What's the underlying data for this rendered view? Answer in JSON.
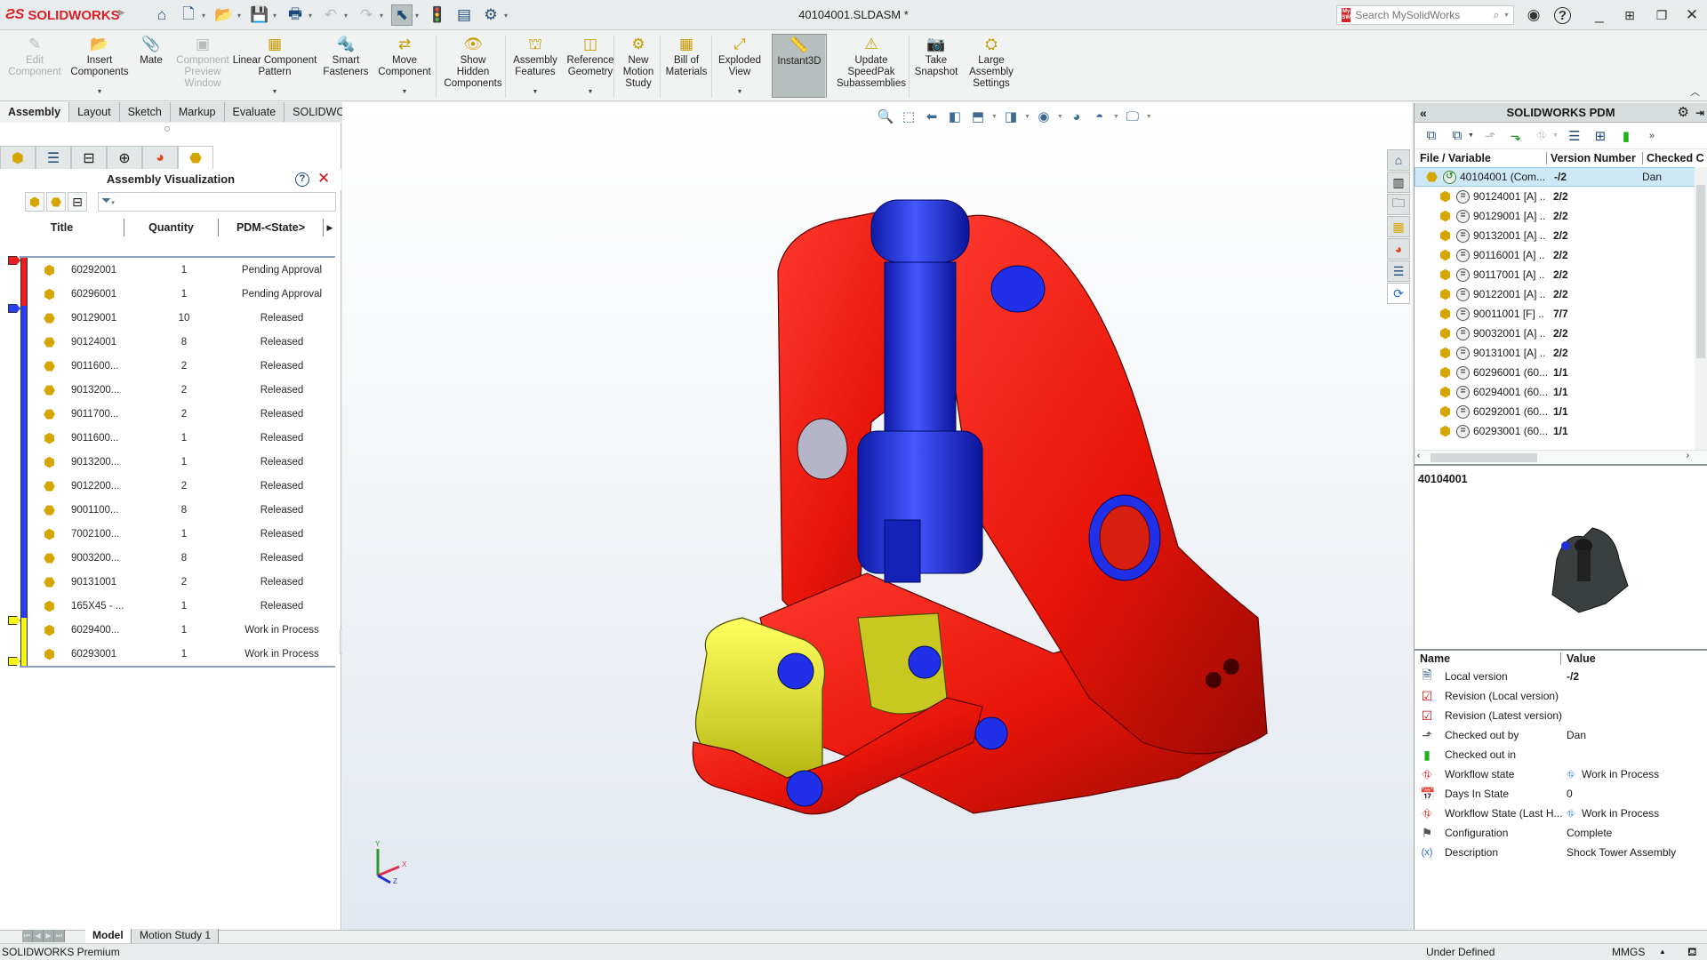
{
  "app": {
    "brand": "SOLIDWORKS",
    "document_title": "40104001.SLDASM *",
    "search_placeholder": "Search MySolidWorks"
  },
  "quick_access": [
    {
      "name": "home",
      "glyph": "⌂"
    },
    {
      "name": "new-document",
      "glyph": "🗋"
    },
    {
      "name": "open",
      "glyph": "📂"
    },
    {
      "name": "save",
      "glyph": "💾"
    },
    {
      "name": "print",
      "glyph": "🖶"
    },
    {
      "name": "undo",
      "glyph": "↶"
    },
    {
      "name": "redo",
      "glyph": "↷"
    },
    {
      "name": "select",
      "glyph": "⬉"
    },
    {
      "name": "rebuild",
      "glyph": "🚦"
    },
    {
      "name": "file-properties",
      "glyph": "▤"
    },
    {
      "name": "options",
      "glyph": "⚙"
    }
  ],
  "ribbon": {
    "commands": [
      {
        "label": "Edit\nComponent",
        "glyph": "✎",
        "disabled": true,
        "caret": false
      },
      {
        "label": "Insert\nComponents",
        "glyph": "📂",
        "disabled": false,
        "caret": true
      },
      {
        "label": "Mate",
        "glyph": "📎",
        "disabled": false,
        "caret": false
      },
      {
        "label": "Component\nPreview\nWindow",
        "glyph": "▣",
        "disabled": true,
        "caret": false
      },
      {
        "label": "Linear Component\nPattern",
        "glyph": "▦",
        "disabled": false,
        "caret": true
      },
      {
        "label": "Smart\nFasteners",
        "glyph": "🔩",
        "disabled": false,
        "caret": false
      },
      {
        "label": "Move\nComponent",
        "glyph": "⇄",
        "disabled": false,
        "caret": true
      },
      {
        "label": "Show\nHidden\nComponents",
        "glyph": "👁",
        "disabled": false,
        "caret": false
      },
      {
        "label": "Assembly\nFeatures",
        "glyph": "⛫",
        "disabled": false,
        "caret": true
      },
      {
        "label": "Reference\nGeometry",
        "glyph": "◫",
        "disabled": false,
        "caret": true
      },
      {
        "label": "New\nMotion\nStudy",
        "glyph": "⚙",
        "disabled": false,
        "caret": false
      },
      {
        "label": "Bill of\nMaterials",
        "glyph": "▦",
        "disabled": false,
        "caret": false
      },
      {
        "label": "Exploded\nView",
        "glyph": "⤢",
        "disabled": false,
        "caret": true
      },
      {
        "label": "Instant3D",
        "glyph": "📏",
        "disabled": false,
        "caret": false,
        "active": true
      },
      {
        "label": "Update\nSpeedPak\nSubassemblies",
        "glyph": "⚠",
        "disabled": false,
        "caret": false
      },
      {
        "label": "Take\nSnapshot",
        "glyph": "📷",
        "disabled": false,
        "caret": false
      },
      {
        "label": "Large\nAssembly\nSettings",
        "glyph": "⛭",
        "disabled": false,
        "caret": false
      }
    ],
    "tabs": [
      "Assembly",
      "Layout",
      "Sketch",
      "Markup",
      "Evaluate",
      "SOLIDWORKS Add-Ins"
    ],
    "active_tab": "Assembly"
  },
  "heads_up_toolbar": [
    {
      "name": "zoom-to-fit",
      "glyph": "🔍"
    },
    {
      "name": "zoom-to-area",
      "glyph": "⬚"
    },
    {
      "name": "previous-view",
      "glyph": "⬅"
    },
    {
      "name": "section-view",
      "glyph": "◧"
    },
    {
      "name": "view-orientation",
      "glyph": "⬒"
    },
    {
      "name": "display-style",
      "glyph": "◨"
    },
    {
      "name": "hide-show-items",
      "glyph": "◉"
    },
    {
      "name": "edit-appearance",
      "glyph": "◕"
    },
    {
      "name": "apply-scene",
      "glyph": "◓"
    },
    {
      "name": "view-settings",
      "glyph": "🖵"
    }
  ],
  "feature_manager": {
    "tabs": [
      "feature-tree",
      "property-manager",
      "configuration-manager",
      "dimxpert",
      "display-manager",
      "assembly-visualization"
    ],
    "panel_title": "Assembly Visualization",
    "columns": [
      "Title",
      "Quantity",
      "PDM-<State>"
    ],
    "rows": [
      {
        "title": "60292001",
        "qty": "1",
        "state": "Pending Approval",
        "type": "part"
      },
      {
        "title": "60296001",
        "qty": "1",
        "state": "Pending Approval",
        "type": "part"
      },
      {
        "title": "90129001",
        "qty": "10",
        "state": "Released",
        "type": "multi"
      },
      {
        "title": "90124001",
        "qty": "8",
        "state": "Released",
        "type": "multi"
      },
      {
        "title": "9011600...",
        "qty": "2",
        "state": "Released",
        "type": "multi"
      },
      {
        "title": "9013200...",
        "qty": "2",
        "state": "Released",
        "type": "multi"
      },
      {
        "title": "9011700...",
        "qty": "2",
        "state": "Released",
        "type": "multi"
      },
      {
        "title": "9011600...",
        "qty": "1",
        "state": "Released",
        "type": "part"
      },
      {
        "title": "9013200...",
        "qty": "1",
        "state": "Released",
        "type": "part"
      },
      {
        "title": "9012200...",
        "qty": "2",
        "state": "Released",
        "type": "multi"
      },
      {
        "title": "9001100...",
        "qty": "8",
        "state": "Released",
        "type": "multi"
      },
      {
        "title": "7002100...",
        "qty": "1",
        "state": "Released",
        "type": "part"
      },
      {
        "title": "9003200...",
        "qty": "8",
        "state": "Released",
        "type": "multi"
      },
      {
        "title": "90131001",
        "qty": "2",
        "state": "Released",
        "type": "multi"
      },
      {
        "title": "165X45 - ...",
        "qty": "1",
        "state": "Released",
        "type": "part"
      },
      {
        "title": "6029400...",
        "qty": "1",
        "state": "Work in Process",
        "type": "part"
      },
      {
        "title": "60293001",
        "qty": "1",
        "state": "Work in Process",
        "type": "part"
      }
    ],
    "state_bar": [
      {
        "state": "Pending Approval",
        "color": "#ee1c1c",
        "count": 2
      },
      {
        "state": "Released",
        "color": "#2b3ff0",
        "count": 13
      },
      {
        "state": "Work in Process",
        "color": "#f5f51a",
        "count": 2
      }
    ]
  },
  "viewport": {
    "model_name": "Shock Tower Assembly",
    "colors": {
      "red": "#ee1b10",
      "blue": "#2030e8",
      "yellow": "#eeee22"
    },
    "triad": {
      "x": "X",
      "y": "Y",
      "z": "Z"
    }
  },
  "bottom_tabs": [
    "Model",
    "Motion Study 1"
  ],
  "active_bottom_tab": "Model",
  "status_bar": {
    "product": "SOLIDWORKS Premium",
    "state": "Under Defined",
    "units": "MMGS"
  },
  "pdm": {
    "title": "SOLIDWORKS PDM",
    "columns": [
      "File / Variable",
      "Version Number",
      "Checked C"
    ],
    "files": [
      {
        "name": "40104001  (Com...",
        "version": "-/2",
        "checked_out": "Dan",
        "level": 0,
        "selected": true
      },
      {
        "name": "90124001  [A] ..",
        "version": "2/2",
        "level": 1
      },
      {
        "name": "90129001  [A] ..",
        "version": "2/2",
        "level": 1
      },
      {
        "name": "90132001  [A] ..",
        "version": "2/2",
        "level": 1
      },
      {
        "name": "90116001  [A] ..",
        "version": "2/2",
        "level": 1
      },
      {
        "name": "90117001  [A] ..",
        "version": "2/2",
        "level": 1
      },
      {
        "name": "90122001  [A] ..",
        "version": "2/2",
        "level": 1
      },
      {
        "name": "90011001  [F] ..",
        "version": "7/7",
        "level": 1
      },
      {
        "name": "90032001  [A] ..",
        "version": "2/2",
        "level": 1
      },
      {
        "name": "90131001  [A] ..",
        "version": "2/2",
        "level": 1
      },
      {
        "name": "60296001  (60...",
        "version": "1/1",
        "level": 1
      },
      {
        "name": "60294001  (60...",
        "version": "1/1",
        "level": 1
      },
      {
        "name": "60292001  (60...",
        "version": "1/1",
        "level": 1
      },
      {
        "name": "60293001  (60...",
        "version": "1/1",
        "level": 1
      }
    ],
    "preview_name": "40104001",
    "props_columns": [
      "Name",
      "Value"
    ],
    "properties": [
      {
        "icon": "local-version",
        "glyph": "🗎",
        "name": "Local version",
        "value": "-/2",
        "bold": true
      },
      {
        "icon": "revision-check",
        "glyph": "☑",
        "name": "Revision (Local version)",
        "value": ""
      },
      {
        "icon": "revision-check",
        "glyph": "☑",
        "name": "Revision (Latest version)",
        "value": ""
      },
      {
        "icon": "check-out",
        "glyph": "⬏",
        "name": "Checked out by",
        "value": "Dan"
      },
      {
        "icon": "checked-out-in",
        "glyph": "▮",
        "name": "Checked out in",
        "value": ""
      },
      {
        "icon": "workflow",
        "glyph": "⛗",
        "name": "Workflow state",
        "value": "Work in Process",
        "value_icon": true
      },
      {
        "icon": "calendar",
        "glyph": "📅",
        "name": "Days In State",
        "value": "0"
      },
      {
        "icon": "workflow",
        "glyph": "⛗",
        "name": "Workflow State (Last H...",
        "value": "Work in Process",
        "value_icon": true
      },
      {
        "icon": "configuration",
        "glyph": "⚑",
        "name": "Configuration",
        "value": "Complete"
      },
      {
        "icon": "variable",
        "glyph": "(x)",
        "name": "Description",
        "value": "Shock Tower Assembly"
      }
    ]
  },
  "task_pane_tabs": [
    "home",
    "design-library",
    "file-explorer",
    "view-palette",
    "appearances",
    "custom-properties",
    "pdm-refresh"
  ]
}
